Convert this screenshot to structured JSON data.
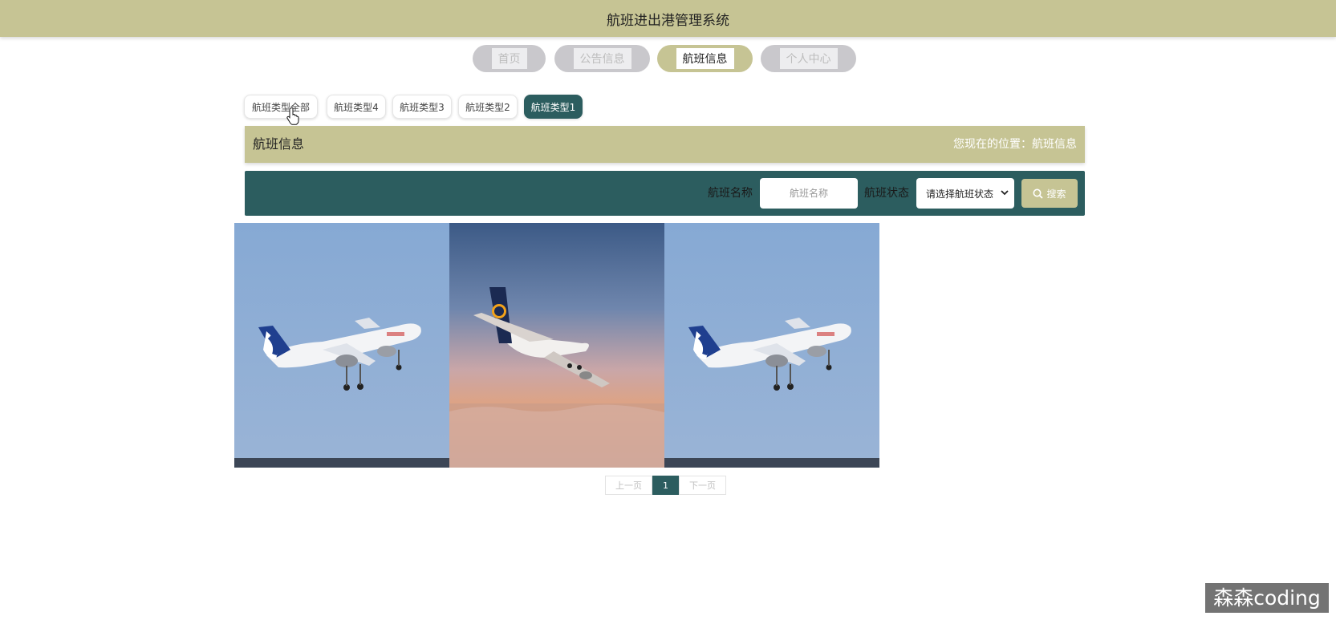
{
  "header": {
    "title": "航班进出港管理系统"
  },
  "nav": {
    "items": [
      {
        "label": "首页",
        "active": false
      },
      {
        "label": "公告信息",
        "active": false
      },
      {
        "label": "航班信息",
        "active": true
      },
      {
        "label": "个人中心",
        "active": false
      }
    ]
  },
  "types": {
    "items": [
      {
        "label": "航班类型全部",
        "active": false
      },
      {
        "label": "航班类型4",
        "active": false
      },
      {
        "label": "航班类型3",
        "active": false
      },
      {
        "label": "航班类型2",
        "active": false
      },
      {
        "label": "航班类型1",
        "active": true
      }
    ]
  },
  "breadcrumb": {
    "title": "航班信息",
    "position_label": "您现在的位置：",
    "position_value": "航班信息"
  },
  "search": {
    "name_label": "航班名称",
    "name_placeholder": "航班名称",
    "status_label": "航班状态",
    "status_selected": "请选择航班状态",
    "button_label": "搜索"
  },
  "flights": [
    {
      "image": "airbus-a320neo-takeoff"
    },
    {
      "image": "lufthansa-747-sunset"
    },
    {
      "image": "airbus-a320neo-takeoff"
    }
  ],
  "pagination": {
    "prev": "上一页",
    "current": "1",
    "next": "下一页"
  },
  "watermark": "森森coding",
  "colors": {
    "accent": "#c6c494",
    "primary": "#2c5d5f"
  }
}
